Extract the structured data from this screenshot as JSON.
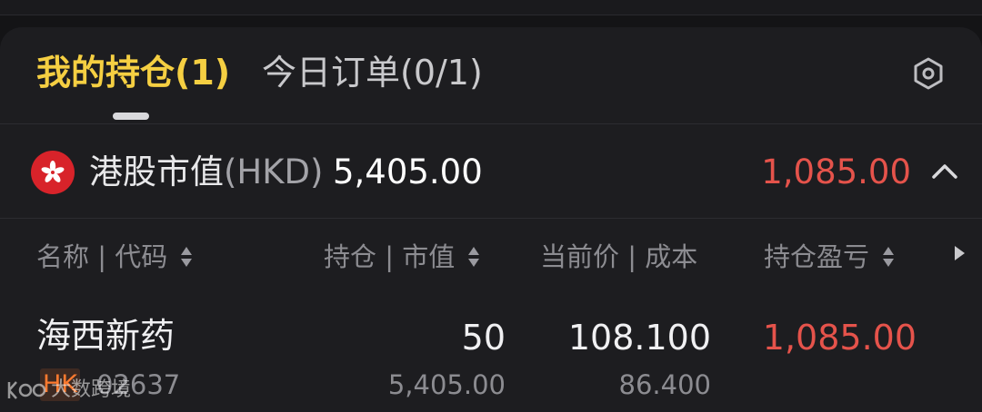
{
  "tabs": [
    {
      "label": "我的持仓(1)",
      "active": true
    },
    {
      "label": "今日订单(0/1)",
      "active": false
    }
  ],
  "settings_icon": "settings-hexagon-icon",
  "summary": {
    "flag_icon": "hong-kong-flag-icon",
    "label": "港股市值",
    "currency": "(HKD)",
    "market_value": "5,405.00",
    "profit_loss": "1,085.00",
    "collapse_icon": "chevron-up-icon"
  },
  "columns": [
    {
      "label": "名称 | 代码",
      "sortable": true
    },
    {
      "label": "持仓 | 市值",
      "sortable": true
    },
    {
      "label": "当前价 | 成本",
      "sortable": false
    },
    {
      "label": "持仓盈亏",
      "sortable": true
    }
  ],
  "positions": [
    {
      "name": "海西新药",
      "market": "HK",
      "code": "02637",
      "quantity": "50",
      "market_value": "5,405.00",
      "current_price": "108.100",
      "cost": "86.400",
      "profit_loss": "1,085.00"
    }
  ],
  "watermark": {
    "text": "大数跨境"
  },
  "colors": {
    "accent": "#f5cf42",
    "loss_profit_red": "#e5534b",
    "market_badge": "#ff7a2f",
    "background": "#1d1d20"
  }
}
